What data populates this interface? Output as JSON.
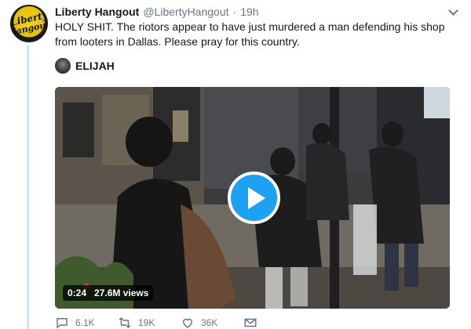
{
  "tweet": {
    "avatar_text_line1": "Liberty",
    "avatar_text_line2": "Hangout",
    "display_name": "Liberty Hangout",
    "handle": "@LibertyHangout",
    "separator": "·",
    "time": "19h",
    "text": "HOLY SHIT. The riotors appear to have just murdered a man defending his shop from looters in Dallas. Please pray for this country.",
    "attribution_name": "ELIJAH"
  },
  "video": {
    "duration": "0:24",
    "views": "27.6M views"
  },
  "actions": {
    "reply_count": "6.1K",
    "retweet_count": "19K",
    "like_count": "36K",
    "message_label": ""
  },
  "colors": {
    "accent": "#1da1f2",
    "thread_line": "#cfe3f2",
    "muted_text": "#657786"
  },
  "icons": [
    "chevron-down-icon",
    "play-icon",
    "reply-icon",
    "retweet-icon",
    "heart-icon",
    "envelope-icon"
  ]
}
